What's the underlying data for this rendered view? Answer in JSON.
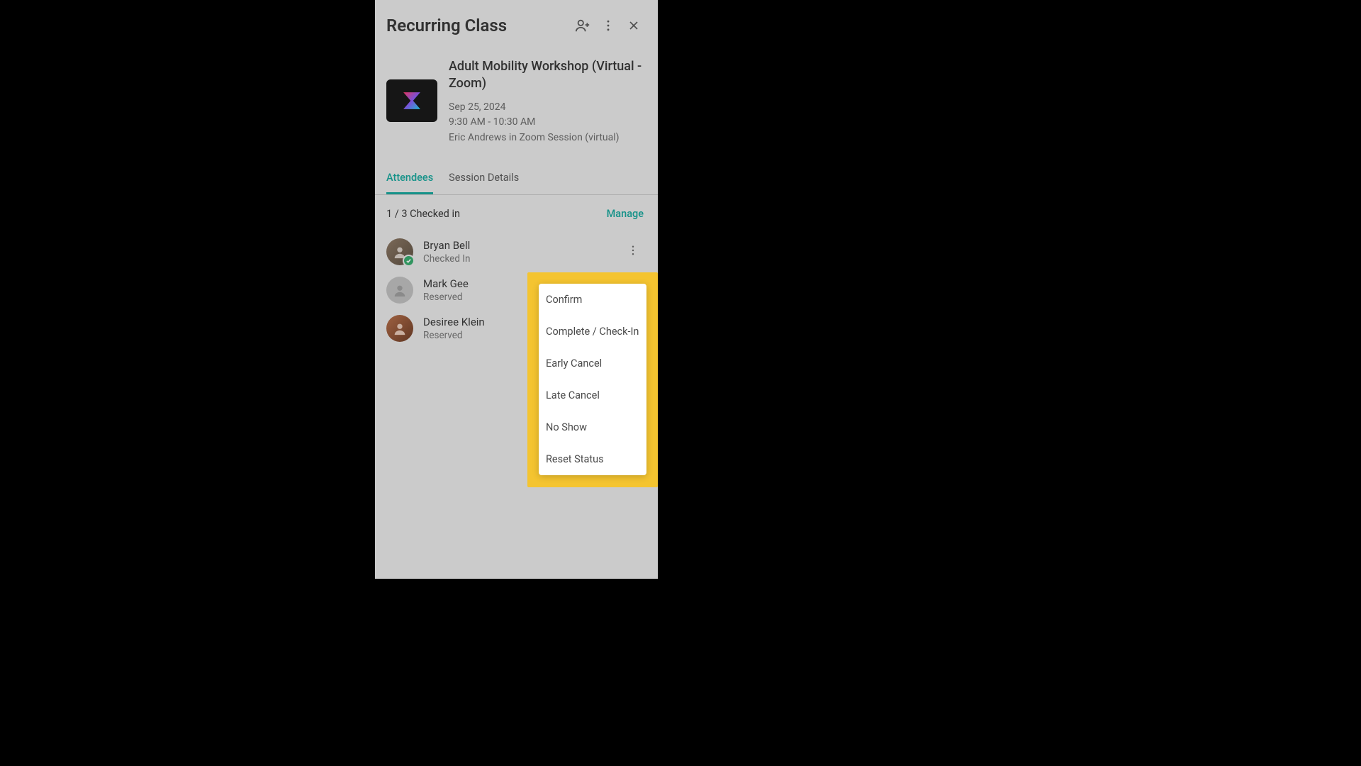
{
  "header": {
    "title": "Recurring Class"
  },
  "session": {
    "name": "Adult Mobility Workshop (Virtual - Zoom)",
    "date": "Sep 25, 2024",
    "time": "9:30 AM - 10:30 AM",
    "host_line": "Eric Andrews in Zoom Session (virtual)"
  },
  "tabs": [
    {
      "label": "Attendees",
      "active": true
    },
    {
      "label": "Session Details",
      "active": false
    }
  ],
  "summary": {
    "checked_in": "1 / 3 Checked in",
    "manage_label": "Manage"
  },
  "attendees": [
    {
      "name": "Bryan Bell",
      "status": "Checked In",
      "checked": true
    },
    {
      "name": "Mark Gee",
      "status": "Reserved",
      "checked": false
    },
    {
      "name": "Desiree Klein",
      "status": "Reserved",
      "checked": false
    }
  ],
  "menu": {
    "items": [
      "Confirm",
      "Complete / Check-In",
      "Early Cancel",
      "Late Cancel",
      "No Show",
      "Reset Status"
    ]
  }
}
